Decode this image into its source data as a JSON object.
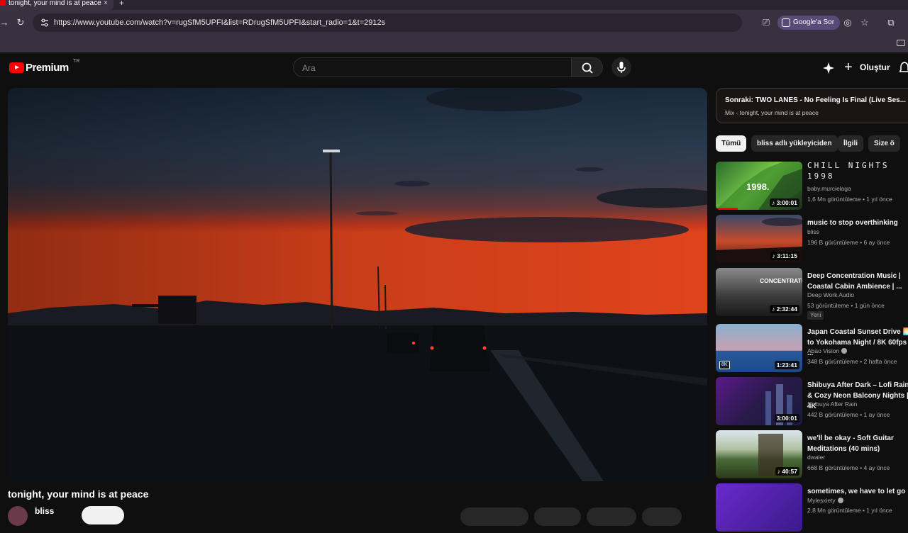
{
  "browser": {
    "tab_title": "tonight, your mind is at peace",
    "new_tab": "+",
    "tab_close": "×",
    "url": "https://www.youtube.com/watch?v=rugSfM5UPFI&list=RDrugSfM5UPFI&start_radio=1&t=2912s",
    "ask_button": "Google'a Sor"
  },
  "header": {
    "logo_text": "Premium",
    "country_code": "TR",
    "search_placeholder": "Ara",
    "create_label": "Oluştur"
  },
  "video": {
    "title": "tonight, your mind is at peace",
    "channel": "bliss"
  },
  "up_next": {
    "title": "Sonraki: TWO LANES - No Feeling Is Final (Live Ses...",
    "subtitle": "Mix - tonight, your mind is at peace"
  },
  "chips": [
    "Tümü",
    "bliss adlı yükleyiciden",
    "İlgili",
    "Size ö"
  ],
  "recommendations": [
    {
      "title": "CHILL NIGHTS 1998",
      "channel": "baby.murcielaga",
      "meta": "1,6 Mn görüntüleme • 1 yıl önce",
      "duration": "3:00:01",
      "thumb_text": "1998."
    },
    {
      "title": "music to stop overthinking",
      "channel": "bliss",
      "meta": "196 B görüntüleme • 6 ay önce",
      "duration": "3:11:15"
    },
    {
      "title": "Deep Concentration Music | Coastal Cabin Ambience | ...",
      "channel": "Deep Work Audio",
      "meta": "53 görüntüleme • 1 gün önce",
      "duration": "2:32:44",
      "badge": "Yeni",
      "thumb_text": "CONCENTRATION MUSIC"
    },
    {
      "title": "Japan Coastal Sunset Drive 🌅 to Yokohama Night / 8K 60fps ...",
      "channel": "Abao Vision",
      "meta": "348 B görüntüleme • 2 hafta önce",
      "duration": "1:23:41",
      "badge8k": "8K",
      "verified": true
    },
    {
      "title": "Shibuya After Dark – Lofi Rain & Cozy Neon Balcony Nights | 4K",
      "channel": "Shibuya After Rain",
      "meta": "442 B görüntüleme • 1 ay önce",
      "duration": "3:00:01"
    },
    {
      "title": "we'll be okay - Soft Guitar Meditations (40 mins)",
      "channel": "dwaler",
      "meta": "668 B görüntüleme • 4 ay önce",
      "duration": "40:57"
    },
    {
      "title": "sometimes, we have to let go",
      "channel": "Mylesxiety",
      "meta": "2,8 Mn görüntüleme • 1 yıl önce",
      "verified": true
    }
  ],
  "colors": {
    "brand_red": "#ff0000",
    "background": "#0f0f0f",
    "chip_active": "#f1f1f1"
  }
}
